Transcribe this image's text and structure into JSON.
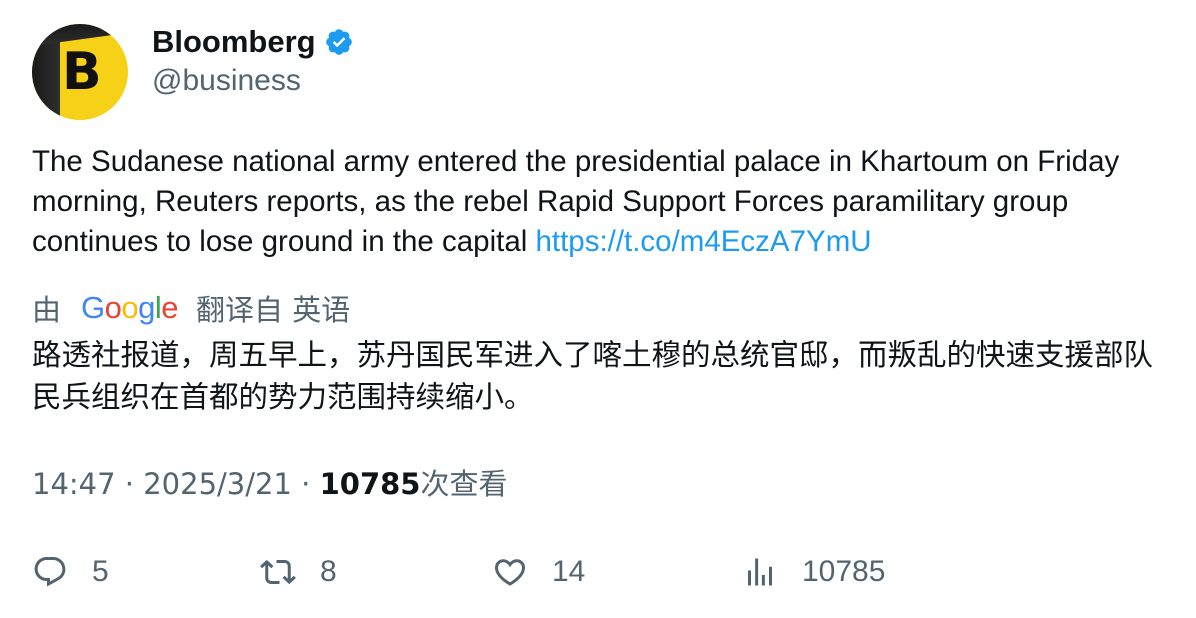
{
  "author": {
    "name": "Bloomberg",
    "handle": "@business",
    "avatar_letter": "B",
    "verified": true
  },
  "tweet": {
    "text": "The Sudanese national army entered the presidential palace in Khartoum on Friday morning, Reuters reports, as the rebel Rapid Support Forces paramilitary group continues to lose ground in the capital",
    "link": "https://t.co/m4EczA7YmU"
  },
  "translation": {
    "by_label": "由",
    "provider": "Google",
    "translated_from_label": "翻译自 英语",
    "text": "路透社报道，周五早上，苏丹国民军进入了喀土穆的总统官邸，而叛乱的快速支援部队民兵组织在首都的势力范围持续缩小。"
  },
  "meta": {
    "time": "14:47",
    "date": "2025/3/21",
    "separator": "·",
    "views_count": "10785",
    "views_label": "次查看"
  },
  "actions": {
    "replies": "5",
    "retweets": "8",
    "likes": "14",
    "views": "10785"
  },
  "colors": {
    "link": "#1d9bf0",
    "verified_badge": "#1d9bf0",
    "secondary_text": "#536471",
    "avatar_bg": "#f7d117"
  }
}
